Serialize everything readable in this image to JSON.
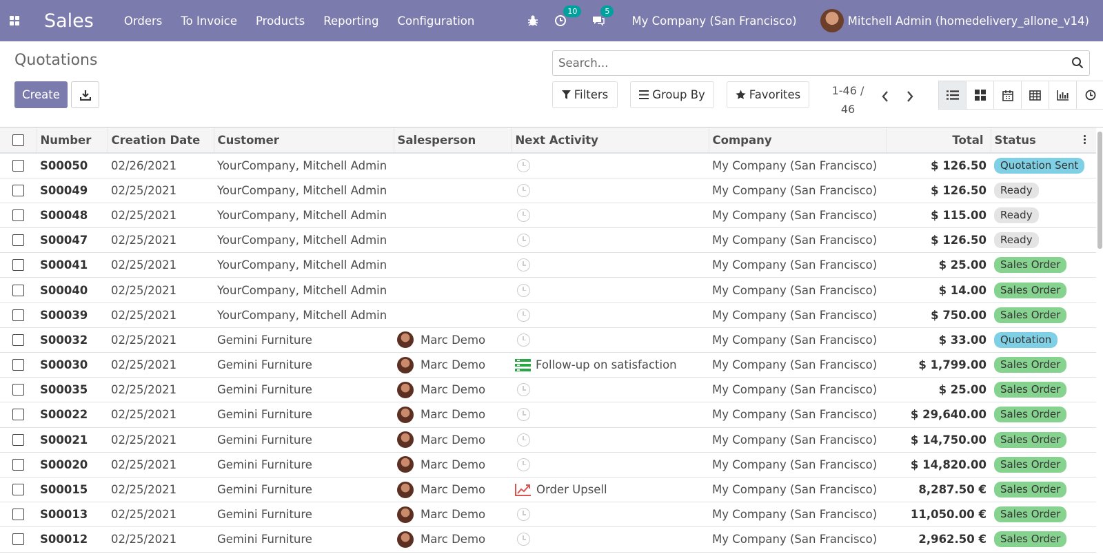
{
  "navbar": {
    "brand": "Sales",
    "menu": [
      "Orders",
      "To Invoice",
      "Products",
      "Reporting",
      "Configuration"
    ],
    "activities_count": "10",
    "messages_count": "5",
    "company": "My Company (San Francisco)",
    "user": "Mitchell Admin (homedelivery_allone_v14)",
    "icons": [
      "apps-icon",
      "bug-icon",
      "clock-icon",
      "chat-icon"
    ]
  },
  "control_panel": {
    "title": "Quotations",
    "create_label": "Create",
    "search_placeholder": "Search...",
    "filters_label": "Filters",
    "group_by_label": "Group By",
    "favorites_label": "Favorites",
    "pager_range": "1-46 /",
    "pager_total": "46",
    "views": [
      "list",
      "kanban",
      "calendar",
      "pivot",
      "graph",
      "activity"
    ],
    "active_view": "list"
  },
  "table": {
    "columns": [
      "Number",
      "Creation Date",
      "Customer",
      "Salesperson",
      "Next Activity",
      "Company",
      "Total",
      "Status"
    ],
    "status_colors": {
      "Quotation Sent": "#7fd0e5",
      "Quotation": "#7fd0e5",
      "Ready": "#e4e4e4",
      "Sales Order": "#86d28f"
    },
    "rows": [
      {
        "number": "S00050",
        "date": "02/26/2021",
        "customer": "YourCompany, Mitchell Admin",
        "salesperson": "",
        "activity": "",
        "activity_icon": "clock-icon",
        "company": "My Company (San Francisco)",
        "total": "$ 126.50",
        "status": "Quotation Sent"
      },
      {
        "number": "S00049",
        "date": "02/25/2021",
        "customer": "YourCompany, Mitchell Admin",
        "salesperson": "",
        "activity": "",
        "activity_icon": "clock-icon",
        "company": "My Company (San Francisco)",
        "total": "$ 126.50",
        "status": "Ready"
      },
      {
        "number": "S00048",
        "date": "02/25/2021",
        "customer": "YourCompany, Mitchell Admin",
        "salesperson": "",
        "activity": "",
        "activity_icon": "clock-icon",
        "company": "My Company (San Francisco)",
        "total": "$ 115.00",
        "status": "Ready"
      },
      {
        "number": "S00047",
        "date": "02/25/2021",
        "customer": "YourCompany, Mitchell Admin",
        "salesperson": "",
        "activity": "",
        "activity_icon": "clock-icon",
        "company": "My Company (San Francisco)",
        "total": "$ 126.50",
        "status": "Ready"
      },
      {
        "number": "S00041",
        "date": "02/25/2021",
        "customer": "YourCompany, Mitchell Admin",
        "salesperson": "",
        "activity": "",
        "activity_icon": "clock-icon",
        "company": "My Company (San Francisco)",
        "total": "$ 25.00",
        "status": "Sales Order"
      },
      {
        "number": "S00040",
        "date": "02/25/2021",
        "customer": "YourCompany, Mitchell Admin",
        "salesperson": "",
        "activity": "",
        "activity_icon": "clock-icon",
        "company": "My Company (San Francisco)",
        "total": "$ 14.00",
        "status": "Sales Order"
      },
      {
        "number": "S00039",
        "date": "02/25/2021",
        "customer": "YourCompany, Mitchell Admin",
        "salesperson": "",
        "activity": "",
        "activity_icon": "clock-icon",
        "company": "My Company (San Francisco)",
        "total": "$ 750.00",
        "status": "Sales Order"
      },
      {
        "number": "S00032",
        "date": "02/25/2021",
        "customer": "Gemini Furniture",
        "salesperson": "Marc Demo",
        "activity": "",
        "activity_icon": "clock-icon",
        "company": "My Company (San Francisco)",
        "total": "$ 33.00",
        "status": "Quotation"
      },
      {
        "number": "S00030",
        "date": "02/25/2021",
        "customer": "Gemini Furniture",
        "salesperson": "Marc Demo",
        "activity": "Follow-up on satisfaction",
        "activity_icon": "tasks-icon",
        "company": "My Company (San Francisco)",
        "total": "$ 1,799.00",
        "status": "Sales Order"
      },
      {
        "number": "S00035",
        "date": "02/25/2021",
        "customer": "Gemini Furniture",
        "salesperson": "Marc Demo",
        "activity": "",
        "activity_icon": "clock-icon",
        "company": "My Company (San Francisco)",
        "total": "$ 25.00",
        "status": "Sales Order"
      },
      {
        "number": "S00022",
        "date": "02/25/2021",
        "customer": "Gemini Furniture",
        "salesperson": "Marc Demo",
        "activity": "",
        "activity_icon": "clock-icon",
        "company": "My Company (San Francisco)",
        "total": "$ 29,640.00",
        "status": "Sales Order"
      },
      {
        "number": "S00021",
        "date": "02/25/2021",
        "customer": "Gemini Furniture",
        "salesperson": "Marc Demo",
        "activity": "",
        "activity_icon": "clock-icon",
        "company": "My Company (San Francisco)",
        "total": "$ 14,750.00",
        "status": "Sales Order"
      },
      {
        "number": "S00020",
        "date": "02/25/2021",
        "customer": "Gemini Furniture",
        "salesperson": "Marc Demo",
        "activity": "",
        "activity_icon": "clock-icon",
        "company": "My Company (San Francisco)",
        "total": "$ 14,820.00",
        "status": "Sales Order"
      },
      {
        "number": "S00015",
        "date": "02/25/2021",
        "customer": "Gemini Furniture",
        "salesperson": "Marc Demo",
        "activity": "Order Upsell",
        "activity_icon": "upsell-chart-icon",
        "company": "My Company (San Francisco)",
        "total": "8,287.50 €",
        "status": "Sales Order"
      },
      {
        "number": "S00013",
        "date": "02/25/2021",
        "customer": "Gemini Furniture",
        "salesperson": "Marc Demo",
        "activity": "",
        "activity_icon": "clock-icon",
        "company": "My Company (San Francisco)",
        "total": "11,050.00 €",
        "status": "Sales Order"
      },
      {
        "number": "S00012",
        "date": "02/25/2021",
        "customer": "Gemini Furniture",
        "salesperson": "Marc Demo",
        "activity": "",
        "activity_icon": "clock-icon",
        "company": "My Company (San Francisco)",
        "total": "2,962.50 €",
        "status": "Sales Order"
      }
    ]
  }
}
